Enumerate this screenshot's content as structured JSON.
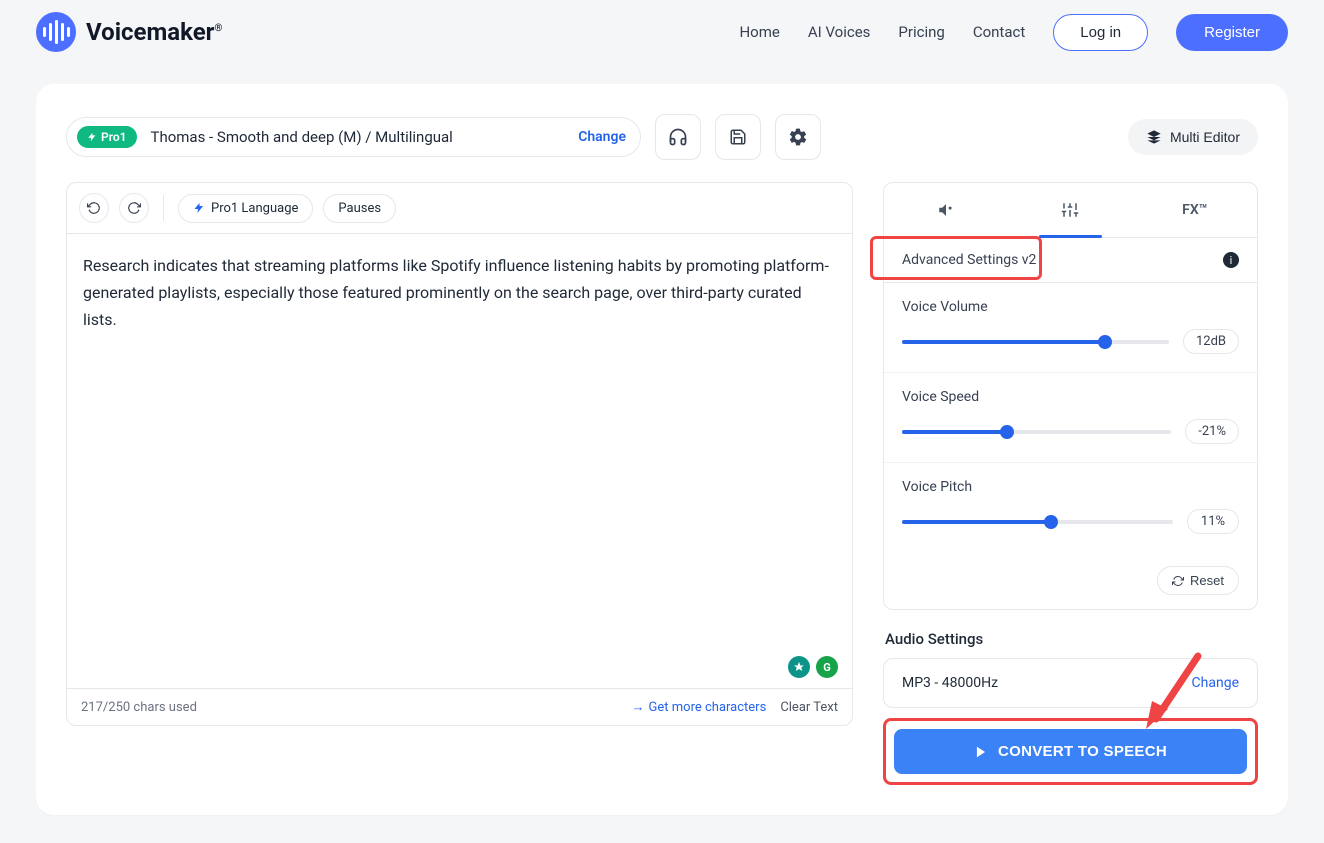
{
  "brand": {
    "name": "Voicemaker",
    "reg": "®"
  },
  "nav": {
    "home": "Home",
    "ai_voices": "AI Voices",
    "pricing": "Pricing",
    "contact": "Contact",
    "login": "Log in",
    "register": "Register"
  },
  "voice_selector": {
    "badge": "Pro1",
    "text": "Thomas - Smooth and deep (M) / Multilingual",
    "change": "Change"
  },
  "toolbar": {
    "multi_editor": "Multi Editor"
  },
  "editor": {
    "chips": {
      "pro1_lang": "Pro1 Language",
      "pauses": "Pauses"
    },
    "text": "Research indicates that streaming platforms like Spotify influence listening habits by promoting platform-generated playlists, especially those featured prominently on the search page, over third-party curated lists.",
    "grammarly_letter": "G",
    "footer": {
      "chars": "217/250 chars used",
      "get_more": "Get more characters",
      "clear": "Clear Text"
    }
  },
  "settings": {
    "tabs": {
      "fx": "FX™"
    },
    "advanced_label": "Advanced Settings v2",
    "sliders": {
      "volume": {
        "label": "Voice Volume",
        "value": "12dB",
        "pct": 76
      },
      "speed": {
        "label": "Voice Speed",
        "value": "-21%",
        "pct": 39
      },
      "pitch": {
        "label": "Voice Pitch",
        "value": "11%",
        "pct": 55
      }
    },
    "reset": "Reset"
  },
  "audio": {
    "label": "Audio Settings",
    "format": "MP3 - 48000Hz",
    "change": "Change",
    "convert": "CONVERT TO SPEECH"
  }
}
